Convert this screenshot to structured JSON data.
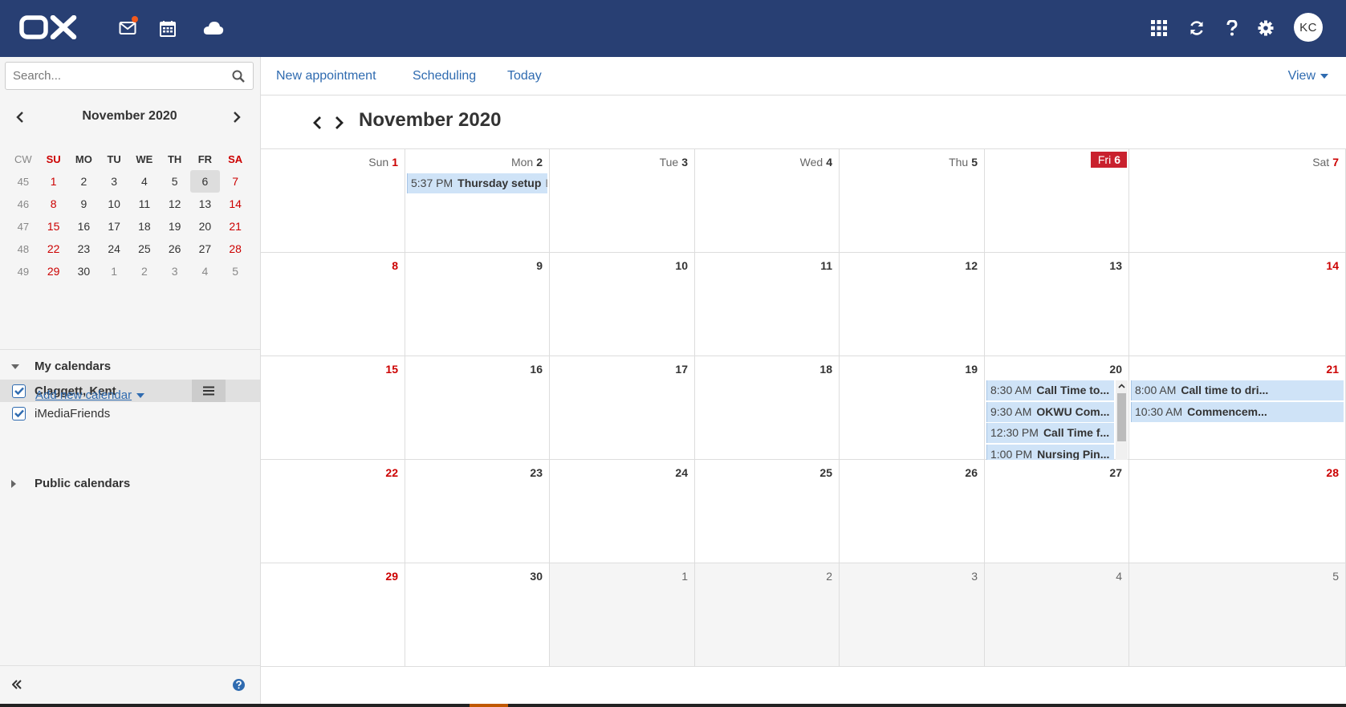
{
  "topbar": {
    "logo_text": "OX",
    "icons": [
      "mail-icon",
      "calendar-icon",
      "cloud-icon",
      "apps-grid-icon",
      "refresh-icon",
      "help-icon",
      "settings-icon"
    ],
    "avatar_initials": "KC",
    "bg_color": "#283f73",
    "notification_color": "#f35a1d"
  },
  "sidebar": {
    "search": {
      "placeholder": "Search..."
    },
    "mini_calendar": {
      "title": "November 2020",
      "header": [
        "CW",
        "SU",
        "MO",
        "TU",
        "WE",
        "TH",
        "FR",
        "SA"
      ],
      "weeks": [
        [
          "45",
          "1",
          "2",
          "3",
          "4",
          "5",
          "6",
          "7"
        ],
        [
          "46",
          "8",
          "9",
          "10",
          "11",
          "12",
          "13",
          "14"
        ],
        [
          "47",
          "15",
          "16",
          "17",
          "18",
          "19",
          "20",
          "21"
        ],
        [
          "48",
          "22",
          "23",
          "24",
          "25",
          "26",
          "27",
          "28"
        ],
        [
          "49",
          "29",
          "30",
          "1",
          "2",
          "3",
          "4",
          "5"
        ]
      ],
      "selected_day": "6"
    },
    "my_calendars": {
      "label": "My calendars",
      "items": [
        {
          "label": "Claggett, Kent",
          "checked": true,
          "active": true
        },
        {
          "label": "iMediaFriends",
          "checked": true,
          "active": false
        }
      ]
    },
    "add_calendar": "Add new calendar",
    "public_calendars": "Public calendars"
  },
  "toolbar": {
    "new_appointment": "New appointment",
    "scheduling": "Scheduling",
    "today": "Today",
    "view": "View"
  },
  "month_view": {
    "title": "November 2020",
    "weeks": [
      [
        {
          "dw": "Sun",
          "d": "1"
        },
        {
          "dw": "Mon",
          "d": "2"
        },
        {
          "dw": "Tue",
          "d": "3"
        },
        {
          "dw": "Wed",
          "d": "4"
        },
        {
          "dw": "Thu",
          "d": "5"
        },
        {
          "dw": "Fri",
          "d": "6",
          "today": true
        },
        {
          "dw": "Sat",
          "d": "7"
        }
      ],
      [
        {
          "d": "8"
        },
        {
          "d": "9"
        },
        {
          "d": "10"
        },
        {
          "d": "11"
        },
        {
          "d": "12"
        },
        {
          "d": "13"
        },
        {
          "d": "14"
        }
      ],
      [
        {
          "d": "15"
        },
        {
          "d": "16"
        },
        {
          "d": "17"
        },
        {
          "d": "18"
        },
        {
          "d": "19"
        },
        {
          "d": "20"
        },
        {
          "d": "21"
        }
      ],
      [
        {
          "d": "22"
        },
        {
          "d": "23"
        },
        {
          "d": "24"
        },
        {
          "d": "25"
        },
        {
          "d": "26"
        },
        {
          "d": "27"
        },
        {
          "d": "28"
        }
      ],
      [
        {
          "d": "29"
        },
        {
          "d": "30"
        },
        {
          "d": "1",
          "out": true
        },
        {
          "d": "2",
          "out": true
        },
        {
          "d": "3",
          "out": true
        },
        {
          "d": "4",
          "out": true
        },
        {
          "d": "5",
          "out": true
        }
      ]
    ],
    "appointments": [
      {
        "week": 0,
        "day": 1,
        "time": "5:37 PM",
        "title": "Thursday setup",
        "location": "BA"
      },
      {
        "week": 2,
        "day": 5,
        "time": "8:30 AM",
        "title": "Call Time to..."
      },
      {
        "week": 2,
        "day": 5,
        "time": "9:30 AM",
        "title": "OKWU Com..."
      },
      {
        "week": 2,
        "day": 5,
        "time": "12:30 PM",
        "title": "Call Time f..."
      },
      {
        "week": 2,
        "day": 5,
        "time": "1:00 PM",
        "title": "Nursing Pin..."
      },
      {
        "week": 2,
        "day": 6,
        "time": "8:00 AM",
        "title": "Call time to dri..."
      },
      {
        "week": 2,
        "day": 6,
        "time": "10:30 AM",
        "title": "Commencem..."
      }
    ],
    "today_color": "#c9212e",
    "appointment_color": "#cfe3f7",
    "weekend_color": "#cc0000"
  }
}
